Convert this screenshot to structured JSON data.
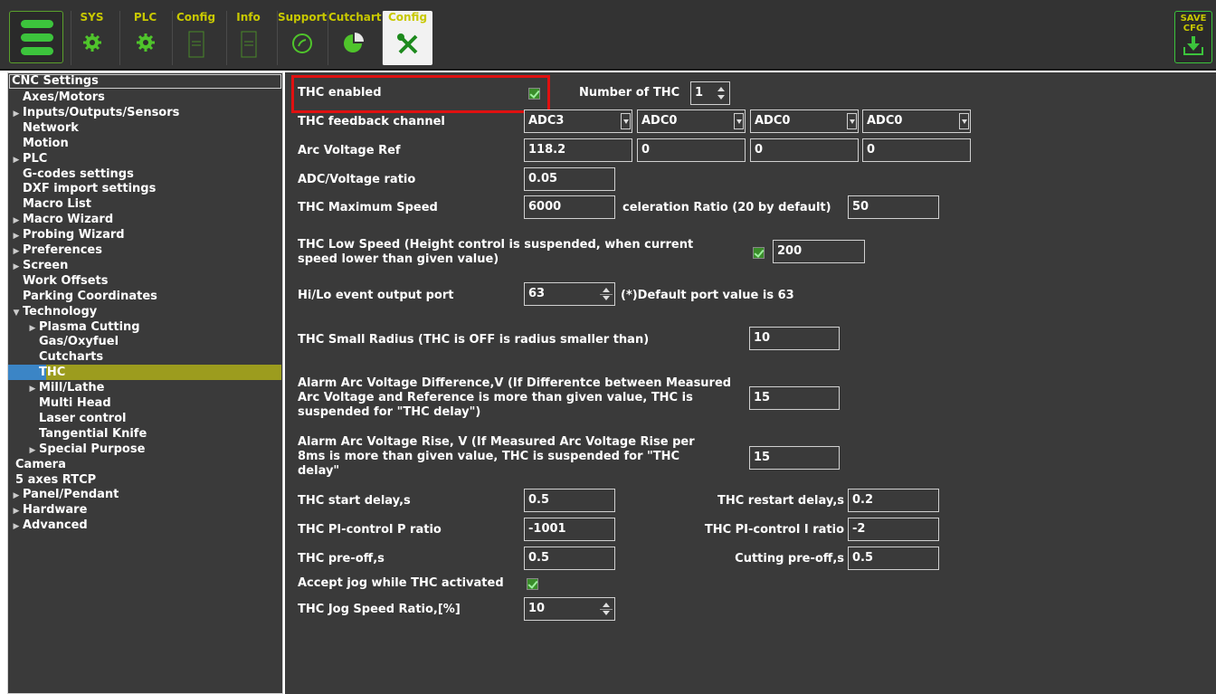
{
  "toolbar": {
    "tabs": [
      {
        "label": "SYS",
        "icon": "gear-icon"
      },
      {
        "label": "PLC",
        "icon": "gear-icon"
      },
      {
        "label": "Config",
        "icon": "document-icon"
      },
      {
        "label": "Info",
        "icon": "document-icon"
      },
      {
        "label": "Support",
        "icon": "phone-icon"
      },
      {
        "label": "Cutchart",
        "icon": "pie-chart-icon"
      },
      {
        "label": "Config",
        "icon": "wrench-screwdriver-icon"
      }
    ],
    "save_label_1": "SAVE",
    "save_label_2": "CFG"
  },
  "sidebar": {
    "header": "CNC Settings",
    "items": [
      {
        "label": "Axes/Motors"
      },
      {
        "label": "Inputs/Outputs/Sensors"
      },
      {
        "label": "Network"
      },
      {
        "label": "Motion"
      },
      {
        "label": "PLC"
      },
      {
        "label": "G-codes settings"
      },
      {
        "label": "DXF import settings"
      },
      {
        "label": "Macro List"
      },
      {
        "label": "Macro Wizard"
      },
      {
        "label": "Probing Wizard"
      },
      {
        "label": "Preferences"
      },
      {
        "label": "Screen"
      },
      {
        "label": "Work Offsets"
      },
      {
        "label": "Parking Coordinates"
      },
      {
        "label": "Technology"
      },
      {
        "label": "Plasma Cutting"
      },
      {
        "label": "Gas/Oxyfuel"
      },
      {
        "label": "Cutcharts"
      },
      {
        "label": "THC"
      },
      {
        "label": "Mill/Lathe"
      },
      {
        "label": "Multi Head"
      },
      {
        "label": "Laser control"
      },
      {
        "label": "Tangential Knife"
      },
      {
        "label": "Special Purpose"
      },
      {
        "label": "Camera"
      },
      {
        "label": "5 axes RTCP"
      },
      {
        "label": "Panel/Pendant"
      },
      {
        "label": "Hardware"
      },
      {
        "label": "Advanced"
      }
    ]
  },
  "form": {
    "thc_enabled_label": "THC enabled",
    "number_of_thc_label": "Number of THC",
    "number_of_thc_value": "1",
    "feedback_channel_label": "THC feedback channel",
    "feedback_channels": [
      "ADC3",
      "ADC0",
      "ADC0",
      "ADC0"
    ],
    "arc_voltage_ref_label": "Arc Voltage Ref",
    "arc_voltage_refs": [
      "118.2",
      "0",
      "0",
      "0"
    ],
    "adc_ratio_label": "ADC/Voltage ratio",
    "adc_ratio_value": "0.05",
    "max_speed_label": "THC Maximum Speed",
    "max_speed_value": "6000",
    "accel_ratio_label": "celeration Ratio (20 by default)",
    "accel_ratio_value": "50",
    "low_speed_label": "THC Low Speed (Height control is suspended, when current speed lower than given value)",
    "low_speed_value": "200",
    "hilo_port_label": "Hi/Lo event output port",
    "hilo_port_value": "63",
    "hilo_port_hint": "(*)Default port value is 63",
    "small_radius_label": "THC Small Radius (THC is OFF is radius smaller than)",
    "small_radius_value": "10",
    "alarm_diff_label": "Alarm Arc Voltage Difference,V (If Differentce between Measured Arc Voltage and Reference is more than given value, THC is suspended for \"THC delay\")",
    "alarm_diff_value": "15",
    "alarm_rise_label": "Alarm Arc Voltage Rise, V (If Measured Arc Voltage Rise per 8ms is more than given value, THC is suspended for \"THC delay\"",
    "alarm_rise_value": "15",
    "start_delay_label": "THC start delay,s",
    "start_delay_value": "0.5",
    "restart_delay_label": "THC restart delay,s",
    "restart_delay_value": "0.2",
    "pi_p_label": "THC PI-control P ratio",
    "pi_p_value": "-1001",
    "pi_i_label": "THC PI-control I ratio",
    "pi_i_value": "-2",
    "pre_off_label": "THC pre-off,s",
    "pre_off_value": "0.5",
    "cutting_pre_off_label": "Cutting pre-off,s",
    "cutting_pre_off_value": "0.5",
    "accept_jog_label": "Accept jog while THC activated",
    "jog_speed_label": "THC Jog Speed Ratio,[%]",
    "jog_speed_value": "10"
  },
  "colors": {
    "background": "#3a3a3a",
    "accent_green": "#3cc43c",
    "tab_label": "#c8c800",
    "selection": "#9c9c1e",
    "highlight": "#e01010"
  }
}
